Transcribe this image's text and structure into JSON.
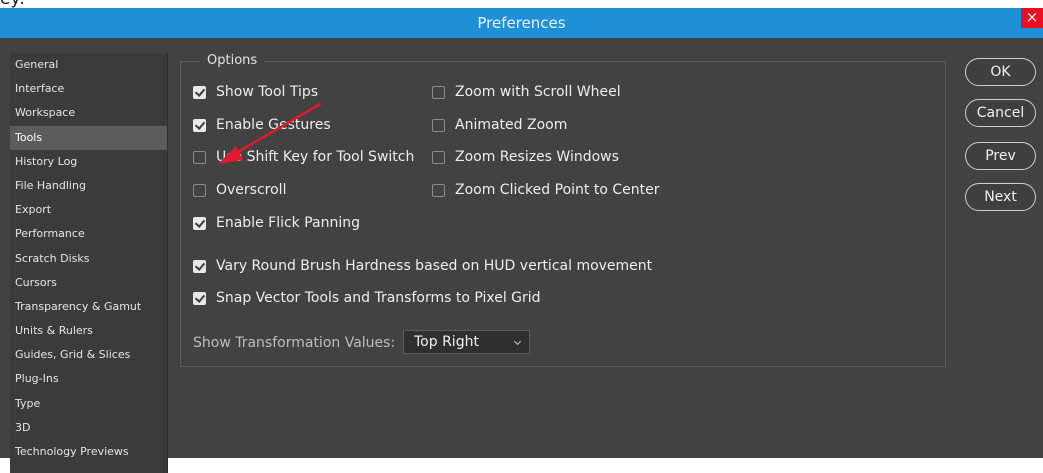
{
  "top_fragment": "ey:",
  "window": {
    "title": "Preferences",
    "close_glyph": "×"
  },
  "sidebar": {
    "items": [
      {
        "label": "General"
      },
      {
        "label": "Interface"
      },
      {
        "label": "Workspace"
      },
      {
        "label": "Tools",
        "selected": true
      },
      {
        "label": "History Log"
      },
      {
        "label": "File Handling"
      },
      {
        "label": "Export"
      },
      {
        "label": "Performance"
      },
      {
        "label": "Scratch Disks"
      },
      {
        "label": "Cursors"
      },
      {
        "label": "Transparency & Gamut"
      },
      {
        "label": "Units & Rulers"
      },
      {
        "label": "Guides, Grid & Slices"
      },
      {
        "label": "Plug-Ins"
      },
      {
        "label": "Type"
      },
      {
        "label": "3D"
      },
      {
        "label": "Technology Previews"
      }
    ]
  },
  "options": {
    "legend": "Options",
    "show_tool_tips": {
      "label": "Show Tool Tips",
      "checked": true
    },
    "enable_gestures": {
      "label": "Enable Gestures",
      "checked": true
    },
    "use_shift_key": {
      "label": "Use Shift Key for Tool Switch",
      "checked": false
    },
    "overscroll": {
      "label": "Overscroll",
      "checked": false
    },
    "enable_flick_panning": {
      "label": "Enable Flick Panning",
      "checked": true
    },
    "zoom_scroll_wheel": {
      "label": "Zoom with Scroll Wheel",
      "checked": false
    },
    "animated_zoom": {
      "label": "Animated Zoom",
      "checked": false
    },
    "zoom_resizes_windows": {
      "label": "Zoom Resizes Windows",
      "checked": false
    },
    "zoom_clicked_point": {
      "label": "Zoom Clicked Point to Center",
      "checked": false
    },
    "vary_round_brush": {
      "label": "Vary Round Brush Hardness based on HUD vertical movement",
      "checked": true
    },
    "snap_vector_tools": {
      "label": "Snap Vector Tools and Transforms to Pixel Grid",
      "checked": true
    },
    "show_transformation_values": {
      "label": "Show Transformation Values:",
      "value": "Top Right"
    }
  },
  "buttons": {
    "ok": "OK",
    "cancel": "Cancel",
    "prev": "Prev",
    "next": "Next"
  },
  "colors": {
    "titlebar": "#1f8fd8",
    "close": "#e81123",
    "dialog_bg": "#424242",
    "annotation_arrow": "#e0192b"
  }
}
